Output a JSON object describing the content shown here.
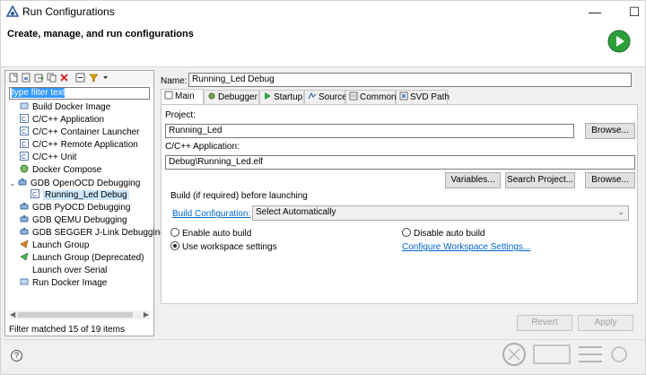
{
  "window": {
    "title": "Run Configurations",
    "minimize": "—",
    "maximize": "☐",
    "close": "✕"
  },
  "header": {
    "text": "Create, manage, and run configurations"
  },
  "left": {
    "filter_text": "type filter text",
    "tree": [
      {
        "label": "Build Docker Image",
        "icon": "docker-build-icon",
        "level": 1
      },
      {
        "label": "C/C++ Application",
        "icon": "c-app-icon",
        "level": 1
      },
      {
        "label": "C/C++ Container Launcher",
        "icon": "c-container-icon",
        "level": 1
      },
      {
        "label": "C/C++ Remote Application",
        "icon": "c-remote-icon",
        "level": 1
      },
      {
        "label": "C/C++ Unit",
        "icon": "c-unit-icon",
        "level": 1
      },
      {
        "label": "Docker Compose",
        "icon": "docker-compose-icon",
        "level": 1
      },
      {
        "label": "GDB OpenOCD Debugging",
        "icon": "gdb-icon",
        "level": 0,
        "expander": "⌄"
      },
      {
        "label": "Running_Led Debug",
        "icon": "config-icon",
        "level": 2,
        "selected": true
      },
      {
        "label": "GDB PyOCD Debugging",
        "icon": "gdb-icon",
        "level": 1
      },
      {
        "label": "GDB QEMU Debugging",
        "icon": "gdb-icon",
        "level": 1
      },
      {
        "label": "GDB SEGGER J-Link Debugging",
        "icon": "gdb-icon",
        "level": 1
      },
      {
        "label": "Launch Group",
        "icon": "launch-group-icon",
        "level": 1
      },
      {
        "label": "Launch Group (Deprecated)",
        "icon": "launch-group-icon",
        "level": 1
      },
      {
        "label": "Launch over Serial",
        "icon": "",
        "level": 1
      },
      {
        "label": "Run Docker Image",
        "icon": "docker-run-icon",
        "level": 1
      }
    ],
    "status": "Filter matched 15 of 19 items"
  },
  "right": {
    "name_label": "Name:",
    "name_value": "Running_Led Debug",
    "tabs": [
      {
        "label": "Main",
        "icon": "main-tab-icon",
        "active": true
      },
      {
        "label": "Debugger",
        "icon": "debugger-tab-icon"
      },
      {
        "label": "Startup",
        "icon": "startup-tab-icon"
      },
      {
        "label": "Source",
        "icon": "source-tab-icon"
      },
      {
        "label": "Common",
        "icon": "common-tab-icon"
      },
      {
        "label": "SVD Path",
        "icon": "svd-tab-icon"
      }
    ],
    "project_label": "Project:",
    "project_value": "Running_Led",
    "browse1": "Browse...",
    "app_label": "C/C++ Application:",
    "app_value": "Debug\\Running_Led.elf",
    "variables": "Variables...",
    "search_project": "Search Project...",
    "browse2": "Browse...",
    "build_group_title": "Build (if required) before launching",
    "build_config_link": "Build Configuration:",
    "build_config_value": "Select Automatically",
    "enable_auto": "Enable auto build",
    "disable_auto": "Disable auto build",
    "workspace_settings": "Use workspace settings",
    "configure_link": "Configure Workspace Settings...",
    "revert": "Revert",
    "apply": "Apply"
  },
  "colors": {
    "selection": "#3399ff",
    "link": "#0066cc",
    "run_green": "#2e9e3a"
  }
}
